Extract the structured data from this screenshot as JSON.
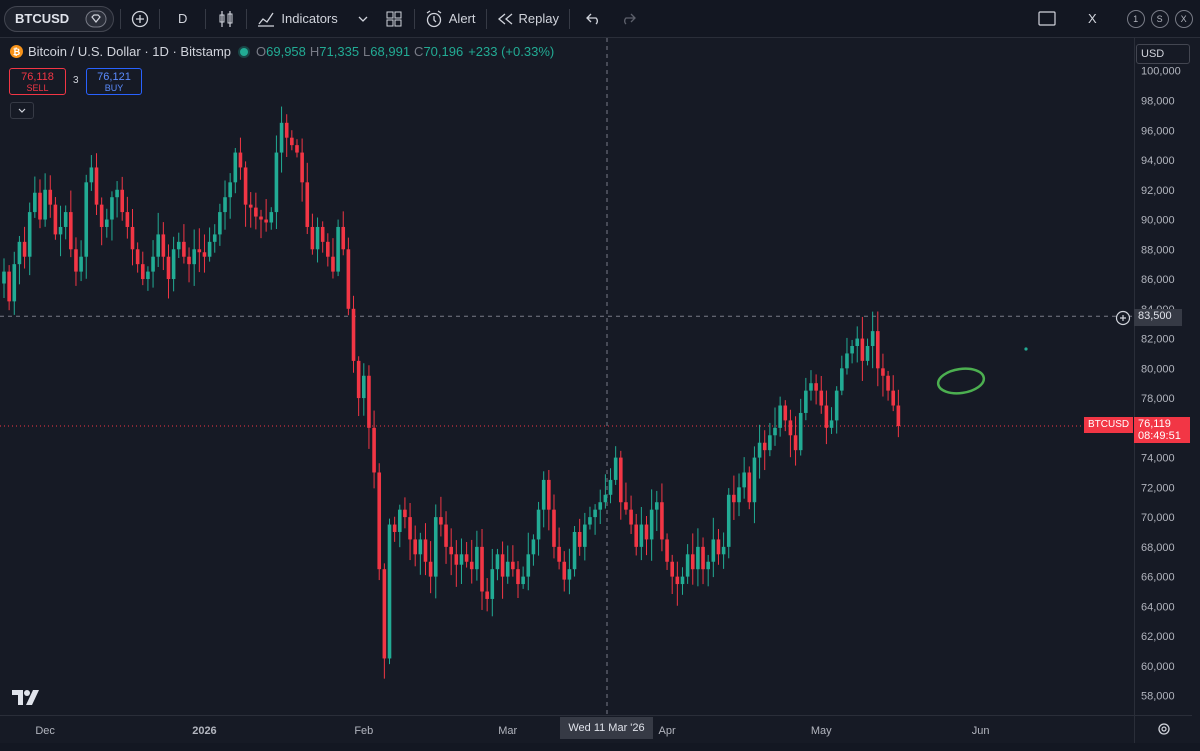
{
  "toolbar": {
    "symbol": "BTCUSD",
    "interval": "D",
    "indicators_label": "Indicators",
    "alert_label": "Alert",
    "replay_label": "Replay",
    "close_label": "X",
    "circle_1": "1",
    "circle_s": "S",
    "circle_x": "X"
  },
  "legend": {
    "title": "Bitcoin / U.S. Dollar · 1D · Bitstamp",
    "o_label": "O",
    "o_val": "69,958",
    "h_label": "H",
    "h_val": "71,335",
    "l_label": "L",
    "l_val": "68,991",
    "c_label": "C",
    "c_val": "70,196",
    "change": "+233 (+0.33%)"
  },
  "trade": {
    "sell_price": "76,118",
    "sell_label": "SELL",
    "spread": "3",
    "buy_price": "76,121",
    "buy_label": "BUY"
  },
  "currency": "USD",
  "crosshair": {
    "price": "83,500",
    "date": "Wed 11 Mar '26"
  },
  "last_price": {
    "symbol": "BTCUSD",
    "price": "76,119",
    "countdown": "08:49:51"
  },
  "colors": {
    "up": "#22ab94",
    "down": "#f23645",
    "bg": "#161a25",
    "annotation": "#4caf50"
  },
  "icons": [
    "diamond-icon",
    "plus-circle-icon",
    "candles-icon",
    "indicators-icon",
    "layouts-icon",
    "alert-icon",
    "replay-icon",
    "undo-icon",
    "redo-icon",
    "fullscreen-icon",
    "settings-gear-icon",
    "tradingview-logo-icon"
  ],
  "chart_data": {
    "type": "candlestick",
    "symbol": "Bitcoin / U.S. Dollar",
    "interval": "1D",
    "exchange": "Bitstamp",
    "y_ticks": [
      58000,
      60000,
      62000,
      64000,
      66000,
      68000,
      70000,
      72000,
      74000,
      76000,
      78000,
      80000,
      82000,
      84000,
      86000,
      88000,
      90000,
      92000,
      94000,
      96000,
      98000,
      100000
    ],
    "y_tick_labels": [
      "58,000",
      "60,000",
      "62,000",
      "64,000",
      "66,000",
      "68,000",
      "70,000",
      "72,000",
      "74,000",
      "76,000",
      "78,000",
      "80,000",
      "82,000",
      "84,000",
      "86,000",
      "88,000",
      "90,000",
      "92,000",
      "94,000",
      "96,000",
      "98,000",
      "100,000"
    ],
    "ylim": [
      56700,
      102200
    ],
    "x_labels": [
      {
        "label": "Dec",
        "bold": false,
        "bar": 8
      },
      {
        "label": "2026",
        "bold": true,
        "bar": 39
      },
      {
        "label": "Feb",
        "bold": false,
        "bar": 70
      },
      {
        "label": "Mar",
        "bold": false,
        "bar": 98
      },
      {
        "label": "Apr",
        "bold": false,
        "bar": 129
      },
      {
        "label": "May",
        "bold": false,
        "bar": 159
      },
      {
        "label": "Jun",
        "bold": false,
        "bar": 190
      }
    ],
    "first_bar_date": "2025-11-23",
    "approximate": true,
    "closes": [
      86500,
      84500,
      87000,
      88500,
      87500,
      90500,
      91800,
      90000,
      92000,
      91000,
      89000,
      89500,
      90500,
      88000,
      86500,
      87500,
      92500,
      93500,
      91000,
      89500,
      90000,
      91500,
      92000,
      90500,
      89500,
      88000,
      87000,
      86000,
      86500,
      87500,
      89000,
      87500,
      86000,
      88000,
      88500,
      87500,
      87000,
      88000,
      87800,
      87500,
      88500,
      89000,
      90500,
      91500,
      92500,
      94500,
      93500,
      91000,
      90800,
      90200,
      90000,
      89800,
      90500,
      94500,
      96500,
      95500,
      95000,
      94500,
      92500,
      89500,
      88000,
      89500,
      88500,
      87500,
      86500,
      89500,
      88000,
      84000,
      80500,
      78000,
      79500,
      76000,
      73000,
      66500,
      60500,
      69500,
      69000,
      70500,
      70000,
      68500,
      67500,
      68500,
      67000,
      66000,
      70000,
      69500,
      68000,
      67500,
      66800,
      67500,
      67000,
      66500,
      68000,
      65000,
      64500,
      66500,
      67500,
      66000,
      67000,
      66500,
      65500,
      66000,
      67500,
      68500,
      70500,
      72500,
      70500,
      68000,
      67000,
      65800,
      66500,
      69000,
      68000,
      69500,
      70000,
      70500,
      71000,
      71500,
      72500,
      74000,
      71000,
      70500,
      69500,
      68000,
      69500,
      68500,
      70500,
      71000,
      68500,
      67000,
      66000,
      65500,
      66000,
      67500,
      66500,
      68000,
      66500,
      67000,
      68500,
      67500,
      68000,
      71500,
      71000,
      72000,
      73000,
      71000,
      74000,
      75000,
      74500,
      75500,
      76000,
      77500,
      76500,
      75500,
      74500,
      77000,
      78500,
      79000,
      78500,
      77500,
      76000,
      76500,
      78500,
      80000,
      81000,
      81500,
      82000,
      80500,
      81500,
      82500,
      80000,
      79500,
      78500,
      77500,
      76119
    ]
  }
}
